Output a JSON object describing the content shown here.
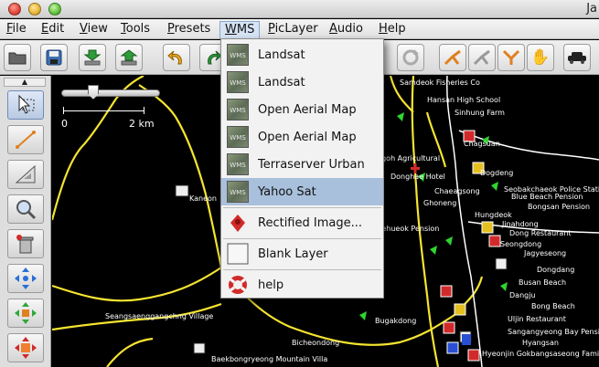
{
  "window": {
    "title": "Ja"
  },
  "menubar": {
    "items": [
      {
        "label": "File"
      },
      {
        "label": "Edit"
      },
      {
        "label": "View"
      },
      {
        "label": "Tools"
      },
      {
        "label": "Presets"
      },
      {
        "label": "WMS"
      },
      {
        "label": "PicLayer"
      },
      {
        "label": "Audio"
      },
      {
        "label": "Help"
      }
    ],
    "open_menu": "WMS"
  },
  "wms_menu": {
    "items": [
      {
        "label": "Landsat",
        "icon": "wms-icon",
        "icon_text": "WMS"
      },
      {
        "label": "Landsat",
        "icon": "wms-icon",
        "icon_text": "WMS"
      },
      {
        "label": "Open Aerial Map",
        "icon": "wms-icon",
        "icon_text": "WMS"
      },
      {
        "label": "Open Aerial Map",
        "icon": "wms-icon",
        "icon_text": "WMS"
      },
      {
        "label": "Terraserver Urban",
        "icon": "wms-icon",
        "icon_text": "WMS"
      },
      {
        "label": "Yahoo Sat",
        "icon": "wms-icon",
        "icon_text": "WMS",
        "selected": true
      }
    ],
    "extra_items": [
      {
        "label": "Rectified Image...",
        "icon": "red-marker-icon"
      },
      {
        "label": "Blank Layer",
        "icon": "blank-square-icon"
      },
      {
        "label": "help",
        "icon": "lifebuoy-icon"
      }
    ]
  },
  "scale_bar": {
    "zoom_fraction": 0.3,
    "label_start": "0",
    "label_end": "2 km"
  },
  "map_labels": [
    "Samdeok Fisheries Co",
    "Hansan High School",
    "Sinhung Farm",
    "Simgoh Agricultural",
    "Chagsuan",
    "Donghae Hotel",
    "Chaeagsong",
    "Dogdeng",
    "Seobakchaeok Police Station",
    "Blue Beach Pension",
    "Hungdeok",
    "Bongsan Pension",
    "Ghoneng",
    "Jinahdong",
    "Badaehueok Pension",
    "Dong Restaurant",
    "Seongdong",
    "Jagyeseong",
    "Seangsaenggangchng Village",
    "Dongdang",
    "Busan Beach",
    "Dangju",
    "Bong Beach",
    "Uljin Restaurant",
    "Sangangyeong Bay Pension",
    "Hyangsan",
    "Hyeonjin Gokbangsaseong Family Pension",
    "Bugakdong",
    "Bicheondong",
    "Baekbongryeong Mountain Villa",
    "Kaneon"
  ],
  "colors": {
    "menu_highlight": "#a9c0dc",
    "road": "#f5e431",
    "poi_green": "#2fd52f",
    "poi_red": "#d22a2a",
    "poi_blue": "#2a4fd2"
  }
}
